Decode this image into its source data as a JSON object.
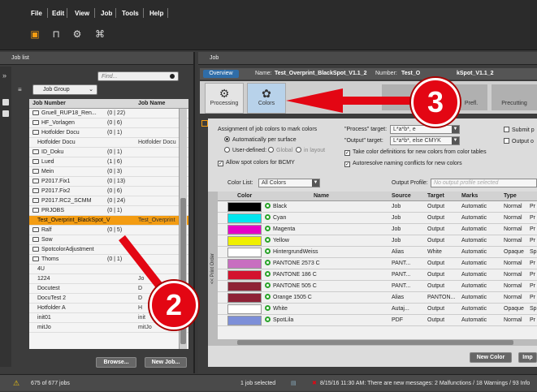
{
  "menu": [
    "File",
    "Edit",
    "View",
    "Job",
    "Tools",
    "Help"
  ],
  "left": {
    "panel_title": "Job list",
    "find_placeholder": "Find...",
    "group_select": "Job Group",
    "col_number": "Job Number",
    "col_name": "Job Name",
    "rows": [
      {
        "num": "Gruell_RUP18_Ren...",
        "count": "(0 | 22)",
        "name": "",
        "folder": true
      },
      {
        "num": "HF_Vorlagen",
        "count": "(0 | 6)",
        "name": "",
        "folder": true
      },
      {
        "num": "Hotfolder Docu",
        "count": "(0 | 1)",
        "name": "",
        "folder": true
      },
      {
        "num": "Hotfolder Docu",
        "count": "",
        "name": "Hotfolder Docu",
        "folder": false
      },
      {
        "num": "ID_Doku",
        "count": "(0 | 1)",
        "name": "",
        "folder": true
      },
      {
        "num": "Lued",
        "count": "(1 | 6)",
        "name": "",
        "folder": true
      },
      {
        "num": "Mein",
        "count": "(0 | 3)",
        "name": "",
        "folder": true
      },
      {
        "num": "P2017.Fix1",
        "count": "(0 | 13)",
        "name": "",
        "folder": true
      },
      {
        "num": "P2017.Fix2",
        "count": "(0 | 6)",
        "name": "",
        "folder": true
      },
      {
        "num": "P2017.RC2_SCMM",
        "count": "(0 | 24)",
        "name": "",
        "folder": true
      },
      {
        "num": "PRJOBS",
        "count": "(0 | 1)",
        "name": "",
        "folder": true
      },
      {
        "num": "Test_Overprint_BlackSpot_V",
        "count": "",
        "name": "Test_Overprint",
        "folder": false,
        "selected": true
      },
      {
        "num": "Ralf",
        "count": "(0 | 5)",
        "name": "",
        "folder": true
      },
      {
        "num": "Sow",
        "count": "",
        "name": "",
        "folder": true
      },
      {
        "num": "SpotcolorAdjustment",
        "count": "",
        "name": "",
        "folder": true
      },
      {
        "num": "Thoms",
        "count": "(0 | 1)",
        "name": "",
        "folder": true
      },
      {
        "num": "4U",
        "count": "",
        "name": "",
        "folder": false
      },
      {
        "num": "1224",
        "count": "",
        "name": "Jo",
        "folder": false
      },
      {
        "num": "Docutest",
        "count": "",
        "name": "D",
        "folder": false
      },
      {
        "num": "DocuTest 2",
        "count": "",
        "name": "D",
        "folder": false
      },
      {
        "num": "Hotfolder A",
        "count": "",
        "name": "H",
        "folder": false
      },
      {
        "num": "init01",
        "count": "",
        "name": "init",
        "folder": false
      },
      {
        "num": "mitJo",
        "count": "",
        "name": "mitJo",
        "folder": false
      }
    ],
    "browse_btn": "Browse...",
    "newjob_btn": "New Job..."
  },
  "right": {
    "panel_title": "Job",
    "overview_btn": "Overview",
    "name_label": "Name:",
    "name_value": "Test_Overprint_BlackSpot_V1.1_2",
    "number_label": "Number:",
    "number_value": "Test_O",
    "number_tail": "kSpot_V1.1_2",
    "tab_processing": "Processing",
    "tab_colors": "Colors",
    "step_d": "D",
    "step_prefl": "Prefl.",
    "step_precutting": "Precutting",
    "assign_label": "Assignment of job colors to mark colors",
    "auto_surface": "Automatically per surface",
    "user_defined": "User-defined:",
    "global": "Global",
    "in_layout": "in layout",
    "allow_spot": "Allow spot colors for BCMY",
    "process_target_label": "\"Process\" target:",
    "process_target_value": "L*a*b*, e",
    "output_target_label": "\"Output\" target:",
    "output_target_value": "L*a*b*, else CMYK",
    "take_color_defs": "Take color definitions for new colors from color tables",
    "autoresolve": "Autoresolve naming conflicts for new colors",
    "submit_label": "Submit p",
    "output_or": "Output o",
    "colorlist_label": "Color List:",
    "colorlist_value": "All Colors",
    "output_profile_label": "Output Profile:",
    "output_profile_placeholder": "No output profile selected",
    "print_order": "<< Print Order",
    "columns": [
      "Color",
      "Name",
      "Source",
      "Target",
      "Marks",
      "Type"
    ],
    "colors": [
      {
        "swatch": "#000000",
        "name": "Black",
        "source": "Job",
        "target": "Output",
        "marks": "Automatic",
        "type": "Normal",
        "extra": "Pr"
      },
      {
        "swatch": "#00e5ee",
        "name": "Cyan",
        "source": "Job",
        "target": "Output",
        "marks": "Automatic",
        "type": "Normal",
        "extra": "Pr"
      },
      {
        "swatch": "#e600c8",
        "name": "Magenta",
        "source": "Job",
        "target": "Output",
        "marks": "Automatic",
        "type": "Normal",
        "extra": "Pr"
      },
      {
        "swatch": "#f0f000",
        "name": "Yellow",
        "source": "Job",
        "target": "Output",
        "marks": "Automatic",
        "type": "Normal",
        "extra": "Pr"
      },
      {
        "swatch": "#ffffff",
        "name": "HintergrundWeiss",
        "source": "Alias",
        "target": "White",
        "marks": "Automatic",
        "type": "Opaque",
        "extra": "Sp"
      },
      {
        "swatch": "#c86ec0",
        "name": "PANTONE 2573 C",
        "source": "PANT...",
        "target": "Output",
        "marks": "Automatic",
        "type": "Normal",
        "extra": "Pr"
      },
      {
        "swatch": "#d3122e",
        "name": "PANTONE 186 C",
        "source": "PANT...",
        "target": "Output",
        "marks": "Automatic",
        "type": "Normal",
        "extra": "Pr"
      },
      {
        "swatch": "#8e2236",
        "name": "PANTONE 505 C",
        "source": "PANT...",
        "target": "Output",
        "marks": "Automatic",
        "type": "Normal",
        "extra": "Pr"
      },
      {
        "swatch": "#8e2236",
        "name": "Orange 1505 C",
        "source": "Alias",
        "target": "PANTON...",
        "marks": "Automatic",
        "type": "Normal",
        "extra": "Pr"
      },
      {
        "swatch": "#ffffff",
        "name": "White",
        "source": "Autaj...",
        "target": "Output",
        "marks": "Automatic",
        "type": "Opaque",
        "extra": "Sp"
      },
      {
        "swatch": "#7d8fd8",
        "name": "SpotLila",
        "source": "PDF",
        "target": "Output",
        "marks": "Automatic",
        "type": "Normal",
        "extra": "Pr"
      }
    ],
    "newcolor_btn": "New Color",
    "imp_btn": "Imp"
  },
  "status": {
    "jobs_count": "675 of 677 jobs",
    "selected": "1 job selected",
    "message": "8/15/16 11:30 AM: There are new messages: 2 Malfunctions / 18 Warnings / 93 Info"
  },
  "overlay": {
    "badge_2": "2",
    "badge_3": "3",
    "accent": "#e30613",
    "selected_row_color": "#f39c12"
  }
}
